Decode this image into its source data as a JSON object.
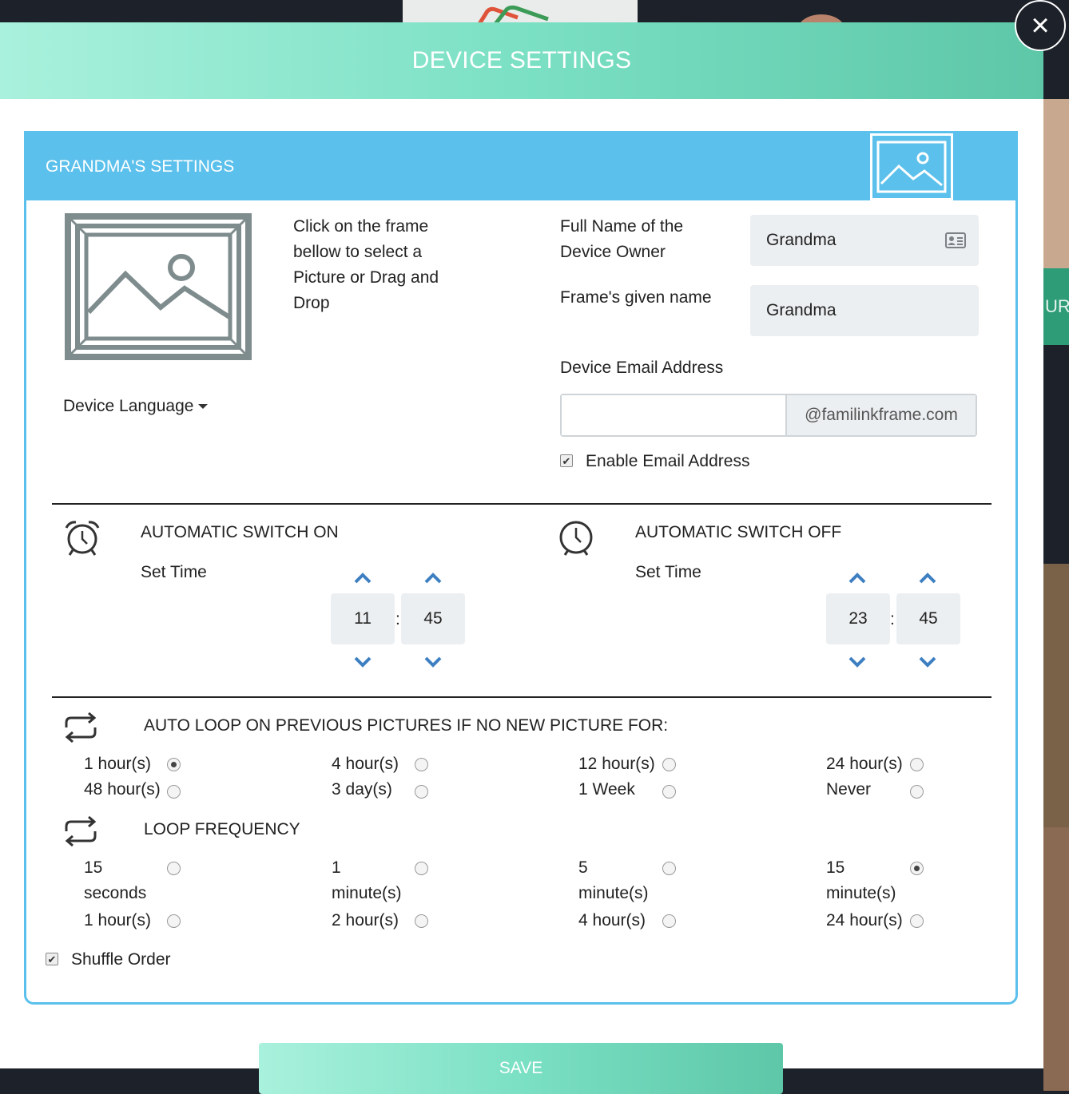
{
  "modal": {
    "title": "DEVICE SETTINGS",
    "close_glyph": "×",
    "save_label": "SAVE"
  },
  "background": {
    "right_tab_text": "URE"
  },
  "panel": {
    "title": "GRANDMA'S SETTINGS",
    "picture_hint": "Click on the frame bellow to select a Picture or Drag and Drop",
    "device_language_label": "Device Language",
    "owner_label": "Full Name of the Device Owner",
    "owner_value": "Grandma",
    "frame_name_label": "Frame's given name",
    "frame_name_value": "Grandma",
    "email_label": "Device Email Address",
    "email_value": "",
    "email_suffix": "@familinkframe.com",
    "enable_email_label": "Enable Email Address",
    "enable_email_checked": true
  },
  "switch_on": {
    "title": "AUTOMATIC SWITCH ON",
    "set_time_label": "Set Time",
    "hour": "11",
    "minute": "45",
    "separator": ":"
  },
  "switch_off": {
    "title": "AUTOMATIC SWITCH OFF",
    "set_time_label": "Set Time",
    "hour": "23",
    "minute": "45",
    "separator": ":"
  },
  "auto_loop": {
    "title": "AUTO LOOP ON PREVIOUS PICTURES IF NO NEW PICTURE FOR:",
    "options": [
      {
        "label": "1 hour(s)",
        "selected": true
      },
      {
        "label": "4 hour(s)",
        "selected": false
      },
      {
        "label": "12 hour(s)",
        "selected": false
      },
      {
        "label": "24 hour(s)",
        "selected": false
      },
      {
        "label": "48 hour(s)",
        "selected": false
      },
      {
        "label": "3 day(s)",
        "selected": false
      },
      {
        "label": "1 Week",
        "selected": false
      },
      {
        "label": "Never",
        "selected": false
      }
    ]
  },
  "loop_frequency": {
    "title": "LOOP FREQUENCY",
    "options": [
      {
        "label": "15 seconds",
        "selected": false
      },
      {
        "label": "1 minute(s)",
        "selected": false
      },
      {
        "label": "5 minute(s)",
        "selected": false
      },
      {
        "label": "15 minute(s)",
        "selected": true
      },
      {
        "label": "1 hour(s)",
        "selected": false
      },
      {
        "label": "2 hour(s)",
        "selected": false
      },
      {
        "label": "4 hour(s)",
        "selected": false
      },
      {
        "label": "24 hour(s)",
        "selected": false
      }
    ]
  },
  "shuffle": {
    "label": "Shuffle Order",
    "checked": true
  },
  "colors": {
    "header_gradient_start": "#a9f1dc",
    "header_gradient_end": "#5ec7a8",
    "panel_accent": "#5bc0eb",
    "chevron": "#3d7fc1"
  },
  "icons": {
    "close": "close-icon",
    "header_image": "image-placeholder-icon",
    "frame": "picture-frame-icon",
    "contact_card": "contact-card-icon",
    "alarm_clock": "alarm-clock-icon",
    "clock": "clock-icon",
    "loop": "loop-icon",
    "chevron_up": "chevron-up-icon",
    "chevron_down": "chevron-down-icon",
    "caret_down": "caret-down-icon"
  }
}
